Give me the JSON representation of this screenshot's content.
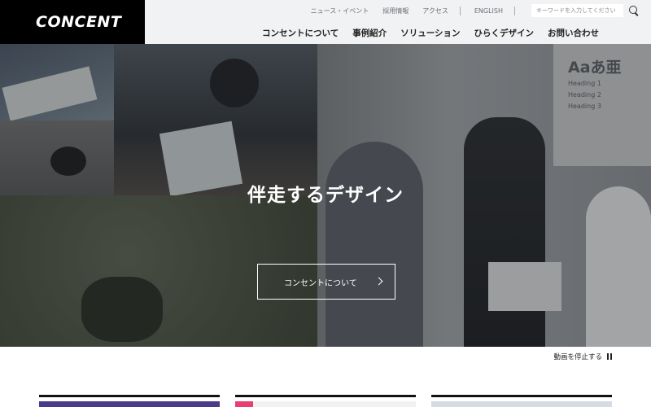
{
  "brand": {
    "logo_text": "CONCENT"
  },
  "utility_nav": {
    "items": [
      "ニュース・イベント",
      "採用情報",
      "アクセス"
    ],
    "language": "ENGLISH",
    "search": {
      "placeholder": "キーワードを入力してください",
      "value": ""
    }
  },
  "main_nav": {
    "items": [
      "コンセントについて",
      "事例紹介",
      "ソリューション",
      "ひらくデザイン",
      "お問い合わせ"
    ]
  },
  "hero": {
    "title": "伴走するデザイン",
    "button_label": "コンセントについて",
    "board_heading": "Aaあ亜",
    "board_lines": [
      "Heading 1",
      "Heading 2",
      "Heading 3"
    ]
  },
  "video_control": {
    "label": "動画を停止する"
  },
  "colors": {
    "header_bg": "#000000",
    "nav_bg": "#f0f2f4",
    "card1_accent": "#4b3a8a",
    "card2_accent": "#e83f72"
  }
}
